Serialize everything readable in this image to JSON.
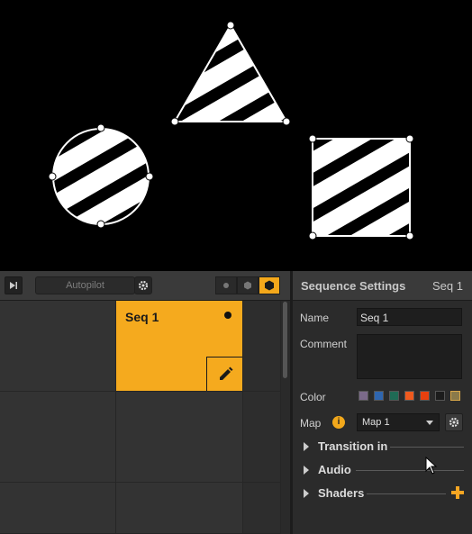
{
  "canvas": {
    "shapes": [
      "circle-shape",
      "triangle-shape",
      "square-shape"
    ]
  },
  "toolbar": {
    "autopilot_label": "Autopilot",
    "skip_icon": "skip-forward-icon",
    "gear_icon": "gear-icon",
    "view_modes": [
      "dot-small",
      "hexagon",
      "hexagon-active"
    ]
  },
  "grid": {
    "active_cell_label": "Seq 1"
  },
  "settings": {
    "title": "Sequence Settings",
    "current_sequence": "Seq 1",
    "name_label": "Name",
    "name_value": "Seq 1",
    "comment_label": "Comment",
    "comment_value": "",
    "color_label": "Color",
    "colors": [
      "#7b6a8a",
      "#2f66b0",
      "#1f6b55",
      "#f05a1e",
      "#e8400e",
      "#1c1c1c",
      "#8a7a4a"
    ],
    "map_label": "Map",
    "map_info": "i",
    "map_value": "Map 1",
    "sections": [
      {
        "label": "Transition in"
      },
      {
        "label": "Audio"
      },
      {
        "label": "Shaders"
      }
    ]
  }
}
